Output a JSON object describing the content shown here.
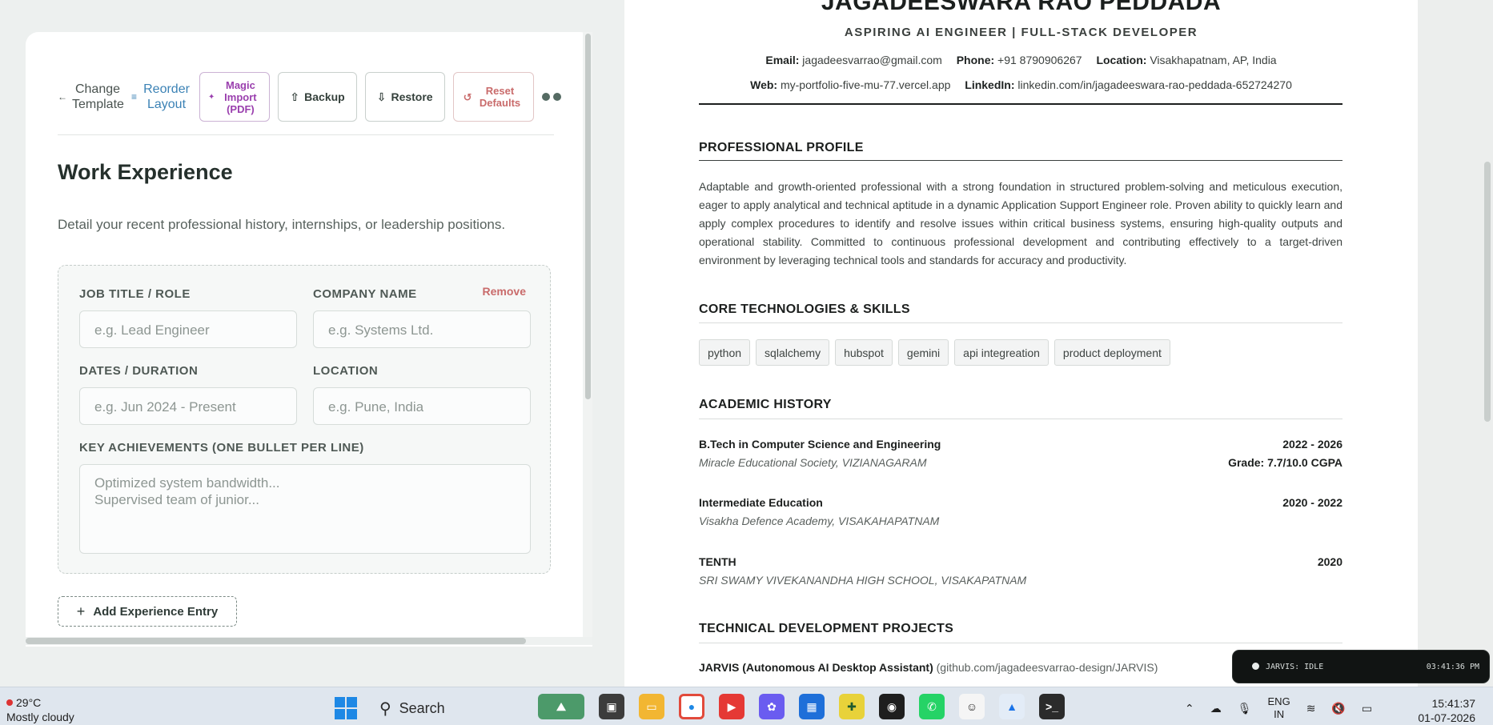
{
  "editor": {
    "toolbar": {
      "change_template": "Change Template",
      "reorder_layout": "Reorder Layout",
      "magic_import": "Magic Import (PDF)",
      "backup": "Backup",
      "restore": "Restore",
      "reset_defaults": "Reset Defaults"
    },
    "section_title": "Work Experience",
    "section_desc": "Detail your recent professional history, internships, or leadership positions.",
    "entry": {
      "remove": "Remove",
      "job_title_label": "JOB TITLE / ROLE",
      "job_title_placeholder": "e.g. Lead Engineer",
      "company_label": "COMPANY NAME",
      "company_placeholder": "e.g. Systems Ltd.",
      "dates_label": "DATES / DURATION",
      "dates_placeholder": "e.g. Jun 2024 - Present",
      "location_label": "LOCATION",
      "location_placeholder": "e.g. Pune, India",
      "achievements_label": "KEY ACHIEVEMENTS (ONE BULLET PER LINE)",
      "achievements_placeholder": "Optimized system bandwidth...\nSupervised team of junior..."
    },
    "add_entry": "Add Experience Entry"
  },
  "resume": {
    "name": "JAGADEESWARA RAO PEDDADA",
    "role": "ASPIRING AI ENGINEER | FULL-STACK DEVELOPER",
    "contact": {
      "email_label": "Email:",
      "email": "jagadeesvarrao@gmail.com",
      "phone_label": "Phone:",
      "phone": "+91 8790906267",
      "location_label": "Location:",
      "location": "Visakhapatnam, AP, India",
      "web_label": "Web:",
      "web": "my-portfolio-five-mu-77.vercel.app",
      "linkedin_label": "LinkedIn:",
      "linkedin": "linkedin.com/in/jagadeeswara-rao-peddada-652724270"
    },
    "profile_heading": "PROFESSIONAL PROFILE",
    "profile_text": "Adaptable and growth-oriented professional with a strong foundation in structured problem-solving and meticulous execution, eager to apply analytical and technical aptitude in a dynamic Application Support Engineer role. Proven ability to quickly learn and apply complex procedures to identify and resolve issues within critical business systems, ensuring high-quality outputs and operational stability. Committed to continuous professional development and contributing effectively to a target-driven environment by leveraging technical tools and standards for accuracy and productivity.",
    "skills_heading": "CORE TECHNOLOGIES & SKILLS",
    "skills": [
      "python",
      "sqlalchemy",
      "hubspot",
      "gemini",
      "api integreation",
      "product deployment"
    ],
    "academic_heading": "ACADEMIC HISTORY",
    "education": [
      {
        "title": "B.Tech in Computer Science and Engineering",
        "institution": "Miracle Educational Society, VIZIANAGARAM",
        "dates": "2022 - 2026",
        "grade": "Grade: 7.7/10.0 CGPA"
      },
      {
        "title": "Intermediate Education",
        "institution": "Visakha Defence Academy, VISAKAHAPATNAM",
        "dates": "2020 - 2022",
        "grade": ""
      },
      {
        "title": "TENTH",
        "institution": "SRI SWAMY VIVEKANANDHA HIGH SCHOOL, VISAKAPATNAM",
        "dates": "2020",
        "grade": ""
      }
    ],
    "projects_heading": "TECHNICAL DEVELOPMENT PROJECTS",
    "project_title": "JARVIS (Autonomous AI Desktop Assistant)",
    "project_link": "(github.com/jagadeesvarrao-design/JARVIS)"
  },
  "jarvis": {
    "status": "JARVIS: IDLE",
    "time": "03:41:36 PM"
  },
  "taskbar": {
    "temp": "29°C",
    "weather": "Mostly cloudy",
    "search": "Search",
    "lang1": "ENG",
    "lang2": "IN",
    "time": "15:41:37",
    "date": "01-07-2026"
  }
}
